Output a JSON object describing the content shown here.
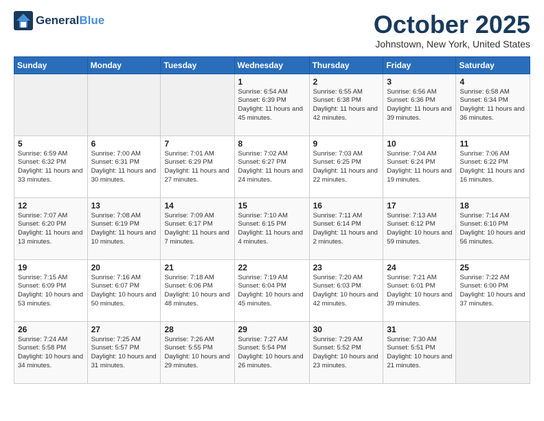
{
  "header": {
    "logo_line1": "General",
    "logo_line2": "Blue",
    "month": "October 2025",
    "location": "Johnstown, New York, United States"
  },
  "days_of_week": [
    "Sunday",
    "Monday",
    "Tuesday",
    "Wednesday",
    "Thursday",
    "Friday",
    "Saturday"
  ],
  "weeks": [
    [
      {
        "day": "",
        "empty": true
      },
      {
        "day": "",
        "empty": true
      },
      {
        "day": "",
        "empty": true
      },
      {
        "day": "1",
        "sunrise": "6:54 AM",
        "sunset": "6:39 PM",
        "daylight": "11 hours and 45 minutes."
      },
      {
        "day": "2",
        "sunrise": "6:55 AM",
        "sunset": "6:38 PM",
        "daylight": "11 hours and 42 minutes."
      },
      {
        "day": "3",
        "sunrise": "6:56 AM",
        "sunset": "6:36 PM",
        "daylight": "11 hours and 39 minutes."
      },
      {
        "day": "4",
        "sunrise": "6:58 AM",
        "sunset": "6:34 PM",
        "daylight": "11 hours and 36 minutes."
      }
    ],
    [
      {
        "day": "5",
        "sunrise": "6:59 AM",
        "sunset": "6:32 PM",
        "daylight": "11 hours and 33 minutes."
      },
      {
        "day": "6",
        "sunrise": "7:00 AM",
        "sunset": "6:31 PM",
        "daylight": "11 hours and 30 minutes."
      },
      {
        "day": "7",
        "sunrise": "7:01 AM",
        "sunset": "6:29 PM",
        "daylight": "11 hours and 27 minutes."
      },
      {
        "day": "8",
        "sunrise": "7:02 AM",
        "sunset": "6:27 PM",
        "daylight": "11 hours and 24 minutes."
      },
      {
        "day": "9",
        "sunrise": "7:03 AM",
        "sunset": "6:25 PM",
        "daylight": "11 hours and 22 minutes."
      },
      {
        "day": "10",
        "sunrise": "7:04 AM",
        "sunset": "6:24 PM",
        "daylight": "11 hours and 19 minutes."
      },
      {
        "day": "11",
        "sunrise": "7:06 AM",
        "sunset": "6:22 PM",
        "daylight": "11 hours and 16 minutes."
      }
    ],
    [
      {
        "day": "12",
        "sunrise": "7:07 AM",
        "sunset": "6:20 PM",
        "daylight": "11 hours and 13 minutes."
      },
      {
        "day": "13",
        "sunrise": "7:08 AM",
        "sunset": "6:19 PM",
        "daylight": "11 hours and 10 minutes."
      },
      {
        "day": "14",
        "sunrise": "7:09 AM",
        "sunset": "6:17 PM",
        "daylight": "11 hours and 7 minutes."
      },
      {
        "day": "15",
        "sunrise": "7:10 AM",
        "sunset": "6:15 PM",
        "daylight": "11 hours and 4 minutes."
      },
      {
        "day": "16",
        "sunrise": "7:11 AM",
        "sunset": "6:14 PM",
        "daylight": "11 hours and 2 minutes."
      },
      {
        "day": "17",
        "sunrise": "7:13 AM",
        "sunset": "6:12 PM",
        "daylight": "10 hours and 59 minutes."
      },
      {
        "day": "18",
        "sunrise": "7:14 AM",
        "sunset": "6:10 PM",
        "daylight": "10 hours and 56 minutes."
      }
    ],
    [
      {
        "day": "19",
        "sunrise": "7:15 AM",
        "sunset": "6:09 PM",
        "daylight": "10 hours and 53 minutes."
      },
      {
        "day": "20",
        "sunrise": "7:16 AM",
        "sunset": "6:07 PM",
        "daylight": "10 hours and 50 minutes."
      },
      {
        "day": "21",
        "sunrise": "7:18 AM",
        "sunset": "6:06 PM",
        "daylight": "10 hours and 48 minutes."
      },
      {
        "day": "22",
        "sunrise": "7:19 AM",
        "sunset": "6:04 PM",
        "daylight": "10 hours and 45 minutes."
      },
      {
        "day": "23",
        "sunrise": "7:20 AM",
        "sunset": "6:03 PM",
        "daylight": "10 hours and 42 minutes."
      },
      {
        "day": "24",
        "sunrise": "7:21 AM",
        "sunset": "6:01 PM",
        "daylight": "10 hours and 39 minutes."
      },
      {
        "day": "25",
        "sunrise": "7:22 AM",
        "sunset": "6:00 PM",
        "daylight": "10 hours and 37 minutes."
      }
    ],
    [
      {
        "day": "26",
        "sunrise": "7:24 AM",
        "sunset": "5:58 PM",
        "daylight": "10 hours and 34 minutes."
      },
      {
        "day": "27",
        "sunrise": "7:25 AM",
        "sunset": "5:57 PM",
        "daylight": "10 hours and 31 minutes."
      },
      {
        "day": "28",
        "sunrise": "7:26 AM",
        "sunset": "5:55 PM",
        "daylight": "10 hours and 29 minutes."
      },
      {
        "day": "29",
        "sunrise": "7:27 AM",
        "sunset": "5:54 PM",
        "daylight": "10 hours and 26 minutes."
      },
      {
        "day": "30",
        "sunrise": "7:29 AM",
        "sunset": "5:52 PM",
        "daylight": "10 hours and 23 minutes."
      },
      {
        "day": "31",
        "sunrise": "7:30 AM",
        "sunset": "5:51 PM",
        "daylight": "10 hours and 21 minutes."
      },
      {
        "day": "",
        "empty": true
      }
    ]
  ]
}
